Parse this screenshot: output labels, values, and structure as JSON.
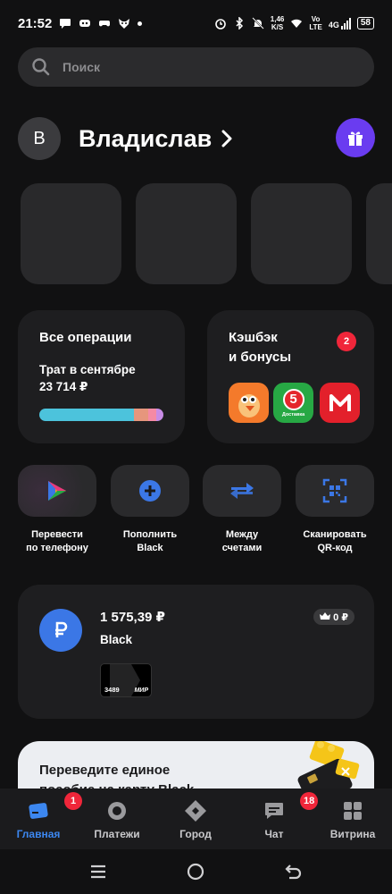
{
  "status_bar": {
    "time": "21:52",
    "net_speed_value": "1,46",
    "net_speed_unit": "K/S",
    "volte_top": "Vo",
    "volte_bottom": "LTE",
    "network": "4G",
    "battery": "58",
    "left_icons": [
      "message-icon",
      "discord-icon",
      "gamepad-icon",
      "fox-icon",
      "dot-icon"
    ],
    "right_icons": [
      "alarm-icon",
      "bluetooth-icon",
      "mute-bell-icon",
      "wifi-icon",
      "signal-icon"
    ]
  },
  "search": {
    "placeholder": "Поиск",
    "icon": "search-icon"
  },
  "profile": {
    "avatar_letter": "В",
    "name": "Владислав",
    "chevron": "›",
    "gift_icon": "gift-icon",
    "gift_color": "#6a3cf0"
  },
  "stories": {
    "count": 4
  },
  "operations": {
    "title": "Все операции",
    "subtitle": "Трат в сентябре",
    "amount": "23 714 ₽",
    "bar_segments": [
      {
        "color": "#4cc3dc",
        "share": 0.76
      },
      {
        "color": "#e6967d",
        "share": 0.12
      },
      {
        "color": "#f58aa5",
        "share": 0.06
      },
      {
        "color": "#c88ce6",
        "share": 0.06
      }
    ]
  },
  "cashback": {
    "title_line1": "Кэшбэк",
    "title_line2": "и бонусы",
    "badge": "2",
    "partners": [
      {
        "name": "bird-partner-logo",
        "color": "#f47a2b",
        "text": ""
      },
      {
        "name": "pyaterochka-logo",
        "color": "#27a844",
        "text": "Доставка"
      },
      {
        "name": "magnit-logo",
        "color": "#e3202b",
        "text": ""
      }
    ]
  },
  "quick_actions": [
    {
      "line1": "Перевести",
      "line2": "по телефону",
      "icon": "sbp-icon"
    },
    {
      "line1": "Пополнить",
      "line2": "Black",
      "icon": "plus-circle-icon"
    },
    {
      "line1": "Между",
      "line2": "счетами",
      "icon": "transfer-arrows-icon"
    },
    {
      "line1": "Сканировать",
      "line2": "QR-код",
      "icon": "qr-scan-icon"
    }
  ],
  "account": {
    "balance": "1 575,39 ₽",
    "name": "Black",
    "cashback_pill": "0 ₽",
    "card_last4": "3489",
    "card_system": "МИР",
    "accent": "#3b77e6"
  },
  "promo": {
    "line1": "Переведите единое",
    "line2": "пособие на карту Black"
  },
  "bottom_nav": [
    {
      "label": "Главная",
      "icon": "home-card-icon",
      "active": true,
      "badge": "1"
    },
    {
      "label": "Платежи",
      "icon": "payments-icon",
      "active": false,
      "badge": ""
    },
    {
      "label": "Город",
      "icon": "city-icon",
      "active": false,
      "badge": ""
    },
    {
      "label": "Чат",
      "icon": "chat-icon",
      "active": false,
      "badge": "18"
    },
    {
      "label": "Витрина",
      "icon": "showcase-icon",
      "active": false,
      "badge": ""
    }
  ],
  "colors": {
    "active_tab": "#3c87f0",
    "badge": "#f0263a",
    "background": "#111112",
    "card": "#1e1e20"
  }
}
